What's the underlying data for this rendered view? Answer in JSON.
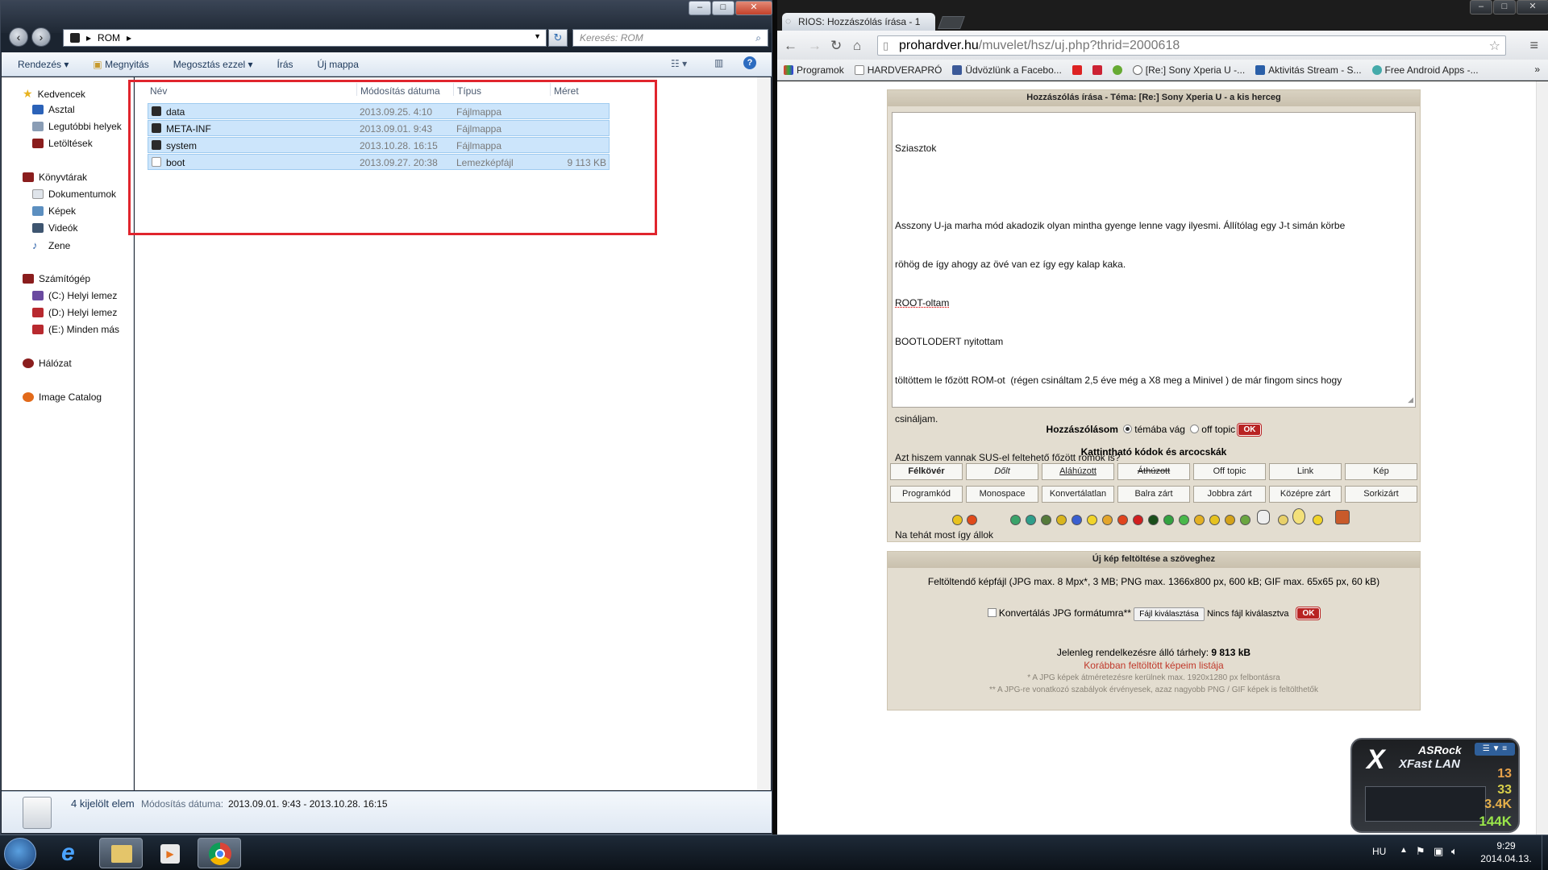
{
  "explorer": {
    "address_segment": "ROM",
    "search_placeholder": "Keresés: ROM",
    "toolbar": [
      "Rendezés ▾",
      "Megnyitás",
      "Megosztás ezzel ▾",
      "Írás",
      "Új mappa"
    ],
    "nav": {
      "favorites": "Kedvencek",
      "fav_items": [
        "Asztal",
        "Legutóbbi helyek",
        "Letöltések"
      ],
      "libraries": "Könyvtárak",
      "lib_items": [
        "Dokumentumok",
        "Képek",
        "Videók",
        "Zene"
      ],
      "computer": "Számítógép",
      "drives": [
        "(C:) Helyi lemez",
        "(D:) Helyi lemez",
        "(E:) Minden más"
      ],
      "network": "Hálózat",
      "image_catalog": "Image Catalog"
    },
    "columns": {
      "name": "Név",
      "date": "Módosítás dátuma",
      "type": "Típus",
      "size": "Méret"
    },
    "files": [
      {
        "name": "data",
        "date": "2013.09.25. 4:10",
        "type": "Fájlmappa",
        "size": ""
      },
      {
        "name": "META-INF",
        "date": "2013.09.01. 9:43",
        "type": "Fájlmappa",
        "size": ""
      },
      {
        "name": "system",
        "date": "2013.10.28. 16:15",
        "type": "Fájlmappa",
        "size": ""
      },
      {
        "name": "boot",
        "date": "2013.09.27. 20:38",
        "type": "Lemezképfájl",
        "size": "9 113 KB"
      }
    ],
    "status": {
      "count": "4 kijelölt elem",
      "modified_label": "Módosítás dátuma:",
      "modified_value": "2013.09.01. 9:43 - 2013.10.28. 16:15"
    }
  },
  "chrome": {
    "tab_title": "RIOS: Hozzászólás írása - 1",
    "url_host": "prohardver.hu",
    "url_path": "/muvelet/hsz/uj.php?thrid=2000618",
    "bookmarks": [
      "Programok",
      "HARDVERAPRÓ",
      "Üdvözlünk a Facebo...",
      "[Re:] Sony Xperia U -...",
      "Aktivitás Stream - S...",
      "Free Android Apps -..."
    ],
    "bookmarks_more": "»"
  },
  "forum": {
    "header": "Hozzászólás írása - Téma: [Re:] Sony Xperia U - a kis herceg",
    "text_lines": [
      "Sziasztok",
      "",
      "Asszony U-ja marha mód akadozik olyan mintha gyenge lenne vagy ilyesmi. Állítólag egy J-t simán körbe",
      "röhög de így ahogy az övé van ez így egy kalap kaka.",
      "ROOT-oltam",
      "BOOTLODERT nyitottam",
      "töltöttem le főzött ROM-ot  (régen csináltam 2,5 éve még a X8 meg a Minivel ) de már fingom sincs hogy",
      "csináljam.",
      "Azt hiszem vannak SUS-el feltehető főzött romok is?",
      "",
      "Na tehát most így állok"
    ],
    "mode_label": "Hozzászólásom",
    "mode_on": "témába vág",
    "mode_off": "off topic",
    "ok": "OK",
    "codes_title": "Kattintható kódok és arcocskák",
    "buttons_row1": [
      "Félkövér",
      "Dőlt",
      "Aláhúzott",
      "Áthúzott",
      "Off topic",
      "Link",
      "Kép"
    ],
    "buttons_row2": [
      "Programkód",
      "Monospace",
      "Konvertálatlan",
      "Balra zárt",
      "Jobbra zárt",
      "Középre zárt",
      "Sorkizárt"
    ],
    "upload_header": "Új kép feltöltése a szöveghez",
    "upload_desc": "Feltöltendő képfájl (JPG max. 8 Mpx*, 3 MB; PNG max. 1366x800 px, 600 kB; GIF max. 65x65 px, 60 kB)",
    "convert_label": "Konvertálás JPG formátumra**",
    "choose_file": "Fájl kiválasztása",
    "no_file": "Nincs fájl kiválasztva",
    "storage_label": "Jelenleg rendelkezésre álló tárhely:",
    "storage_value": "9 813 kB",
    "prev_uploads": "Korábban feltöltött képeim listája",
    "note1": "* A JPG képek átméretezésre kerülnek max. 1920x1280 px felbontásra",
    "note2": "** A JPG-re vonatkozó szabályok érvényesek, azaz nagyobb PNG / GIF képek is feltölthetők"
  },
  "widget": {
    "brand": "ASRock",
    "title": "XFast LAN",
    "values": [
      "13",
      "33",
      "3.4K",
      "144K"
    ]
  },
  "taskbar": {
    "lang": "HU",
    "time": "9:29",
    "date": "2014.04.13."
  },
  "colors": {
    "highlight": "#e0252d",
    "forum_panel": "#e3ddd0",
    "ok_red": "#b82323",
    "link_red": "#c0392b"
  }
}
